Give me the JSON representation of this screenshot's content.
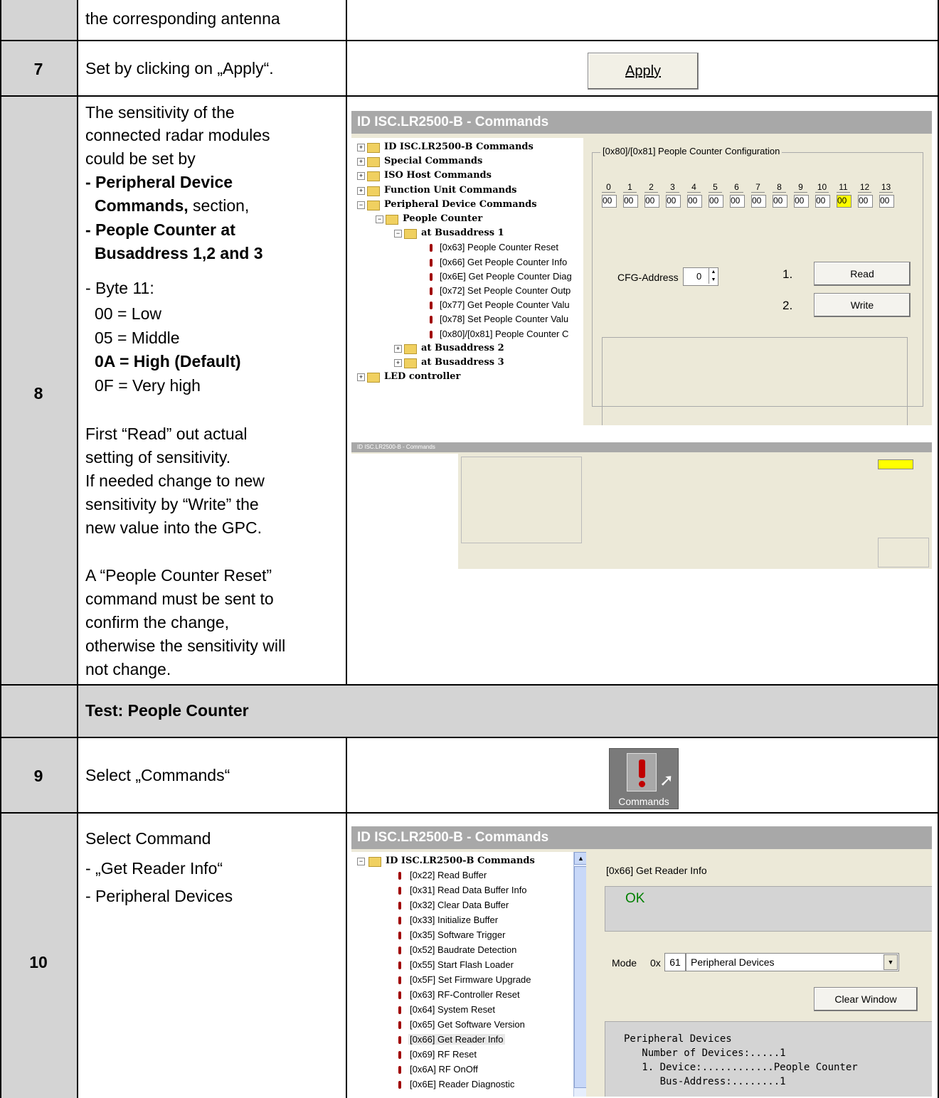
{
  "row_cont": {
    "text": "the corresponding antenna"
  },
  "row7": {
    "num": "7",
    "text": "Set by clicking on „Apply“.",
    "apply_label": "Apply"
  },
  "row8": {
    "num": "8",
    "lines": [
      "The sensitivity of the",
      "connected radar modules",
      "could be set by",
      "- Peripheral Device",
      "Commands,",
      "section,",
      "- People Counter at",
      "Busaddress 1,2 and 3",
      "- Byte 11:",
      "00 = Low",
      "05 = Middle",
      "0A = High (Default)",
      "0F = Very high",
      "First “Read” out actual",
      "setting of sensitivity.",
      "If needed change to new",
      "sensitivity by “Write” the",
      "new value into the GPC.",
      "A “People Counter Reset”",
      "command must be sent  to",
      "confirm the change,",
      "otherwise the sensitivity will",
      "not change."
    ],
    "screen1": {
      "title": "ID ISC.LR2500-B - Commands",
      "tree": [
        "ID ISC.LR2500-B Commands",
        "Special Commands",
        "ISO Host Commands",
        "Function Unit Commands",
        "Peripheral Device Commands",
        "People Counter",
        "at Busaddress 1",
        "[0x63] People Counter Reset",
        "[0x66] Get People Counter Info",
        "[0x6E] Get People Counter Diag",
        "[0x72] Set People Counter Outp",
        "[0x77] Get People Counter Valu",
        "[0x78] Set People Counter Valu",
        "[0x80]/[0x81] People Counter C",
        "at Busaddress 2",
        "at Busaddress 3",
        "LED controller"
      ],
      "group_title": "[0x80]/[0x81] People Counter Configuration",
      "byte_indices": [
        "0",
        "1",
        "2",
        "3",
        "4",
        "5",
        "6",
        "7",
        "8",
        "9",
        "10",
        "11",
        "12",
        "13"
      ],
      "byte_values": [
        "00",
        "00",
        "00",
        "00",
        "00",
        "00",
        "00",
        "00",
        "00",
        "00",
        "00",
        "00",
        "00",
        "00"
      ],
      "highlight_color": "#ffff00",
      "cfg_label": "CFG-Address",
      "cfg_value": "0",
      "step1": "1.",
      "step2": "2.",
      "read_label": "Read",
      "write_label": "Write"
    }
  },
  "test_row": {
    "text": "Test: People Counter"
  },
  "row9": {
    "num": "9",
    "text": "Select „Commands“",
    "icon_label": "Commands"
  },
  "row10": {
    "num": "10",
    "lines": [
      "Select Command",
      "- „Get Reader Info“",
      "-  Peripheral Devices"
    ],
    "screen": {
      "title": "ID ISC.LR2500-B - Commands",
      "tree_root": "ID ISC.LR2500-B Commands",
      "tree": [
        "[0x22] Read Buffer",
        "[0x31] Read Data Buffer Info",
        "[0x32] Clear Data Buffer",
        "[0x33] Initialize Buffer",
        "[0x35] Software Trigger",
        "[0x52] Baudrate Detection",
        "[0x55] Start Flash Loader",
        "[0x5F] Set Firmware Upgrade",
        "[0x63] RF-Controller Reset",
        "[0x64] System Reset",
        "[0x65] Get Software Version",
        "[0x66] Get Reader Info",
        "[0x69] RF Reset",
        "[0x6A] RF OnOff",
        "[0x6E] Reader Diagnostic"
      ],
      "cmd_title": "[0x66] Get Reader Info",
      "status": "OK",
      "status_color": "#008000",
      "mode_label": "Mode",
      "mode_prefix": "0x",
      "mode_value": "61",
      "mode_option": "Peripheral Devices",
      "clear_label": "Clear Window",
      "output": [
        "Peripheral Devices",
        "   Number of Devices:.....1",
        "   1. Device:............People Counter",
        "      Bus-Address:........1"
      ]
    }
  }
}
